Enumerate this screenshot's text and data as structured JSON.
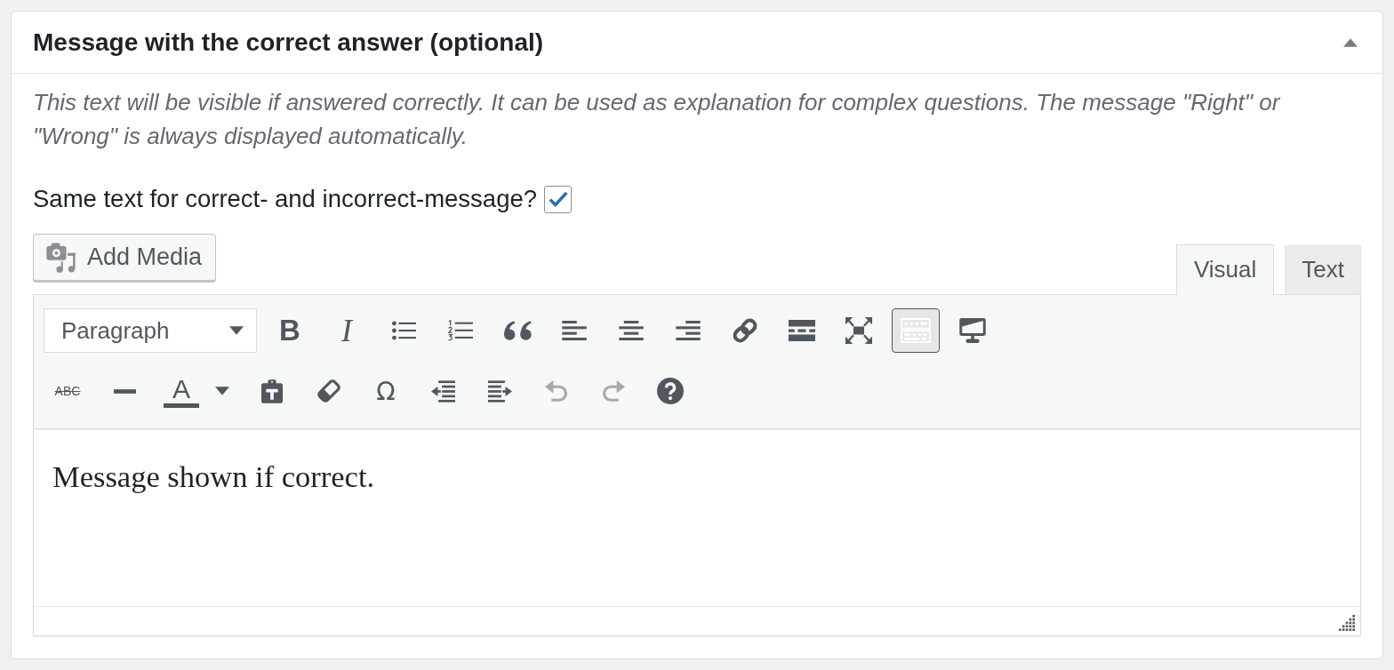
{
  "panel": {
    "title": "Message with the correct answer (optional)",
    "expanded": true
  },
  "description": "This text will be visible if answered correctly. It can be used as explanation for complex questions. The message \"Right\" or \"Wrong\" is always displayed automatically.",
  "same_text_option": {
    "label": "Same text for correct- and incorrect-message?",
    "checked": true
  },
  "editor": {
    "add_media": {
      "label": "Add Media"
    },
    "tabs": [
      {
        "label": "Visual",
        "selected": true
      },
      {
        "label": "Text",
        "selected": false
      }
    ],
    "toolbar": {
      "format_select": {
        "value": "Paragraph"
      },
      "rows": [
        [
          {
            "kind": "bold",
            "glyph": "B",
            "pressed": false,
            "disabled": false
          },
          {
            "kind": "italic",
            "glyph": "I",
            "pressed": false,
            "disabled": false
          },
          {
            "kind": "bullet-list",
            "pressed": false,
            "disabled": false
          },
          {
            "kind": "numbered-list",
            "pressed": false,
            "disabled": false
          },
          {
            "kind": "blockquote",
            "pressed": false,
            "disabled": false
          },
          {
            "kind": "align-left",
            "pressed": false,
            "disabled": false
          },
          {
            "kind": "align-center",
            "pressed": false,
            "disabled": false
          },
          {
            "kind": "align-right",
            "pressed": false,
            "disabled": false
          },
          {
            "kind": "link",
            "pressed": false,
            "disabled": false
          },
          {
            "kind": "read-more",
            "pressed": false,
            "disabled": false
          },
          {
            "kind": "fullscreen",
            "pressed": false,
            "disabled": false
          },
          {
            "kind": "toolbar-toggle",
            "pressed": true,
            "disabled": false
          },
          {
            "kind": "distraction-free",
            "pressed": false,
            "disabled": false
          }
        ],
        [
          {
            "kind": "strikethrough",
            "glyph": "ABC",
            "pressed": false,
            "disabled": false
          },
          {
            "kind": "horizontal-line",
            "pressed": false,
            "disabled": false
          },
          {
            "kind": "text-color",
            "glyph": "A",
            "pressed": false,
            "disabled": false
          },
          {
            "kind": "paste-text",
            "pressed": false,
            "disabled": false
          },
          {
            "kind": "clear-formatting",
            "pressed": false,
            "disabled": false
          },
          {
            "kind": "special-character",
            "glyph": "Ω",
            "pressed": false,
            "disabled": false
          },
          {
            "kind": "outdent",
            "pressed": false,
            "disabled": false
          },
          {
            "kind": "indent",
            "pressed": false,
            "disabled": false
          },
          {
            "kind": "undo",
            "pressed": false,
            "disabled": true
          },
          {
            "kind": "redo",
            "pressed": false,
            "disabled": true
          },
          {
            "kind": "help",
            "pressed": false,
            "disabled": false
          }
        ]
      ]
    },
    "content": "Message shown if correct."
  }
}
